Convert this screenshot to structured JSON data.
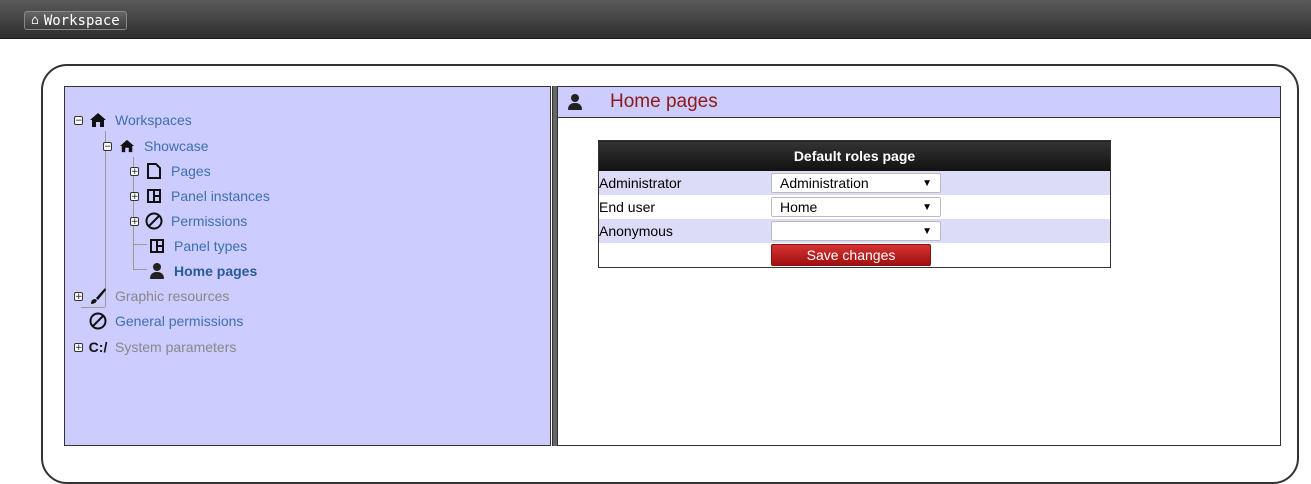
{
  "topbar": {
    "workspace_label": "Workspace",
    "home_icon": "⌂"
  },
  "tree": {
    "workspaces": "Workspaces",
    "showcase": "Showcase",
    "pages": "Pages",
    "panel_instances": "Panel instances",
    "permissions": "Permissions",
    "panel_types": "Panel types",
    "home_pages": "Home pages",
    "graphic_resources": "Graphic resources",
    "general_permissions": "General permissions",
    "system_parameters": "System parameters"
  },
  "content": {
    "title": "Home pages",
    "table_header": "Default roles page",
    "rows": [
      {
        "role": "Administrator",
        "value": "Administration"
      },
      {
        "role": "End user",
        "value": "Home"
      },
      {
        "role": "Anonymous",
        "value": ""
      }
    ],
    "save_label": "Save changes"
  },
  "colors": {
    "accent": "#8b1a1a",
    "panel_bg": "#ccccff",
    "save_button": "#c62020",
    "link": "#3d6fb0"
  }
}
